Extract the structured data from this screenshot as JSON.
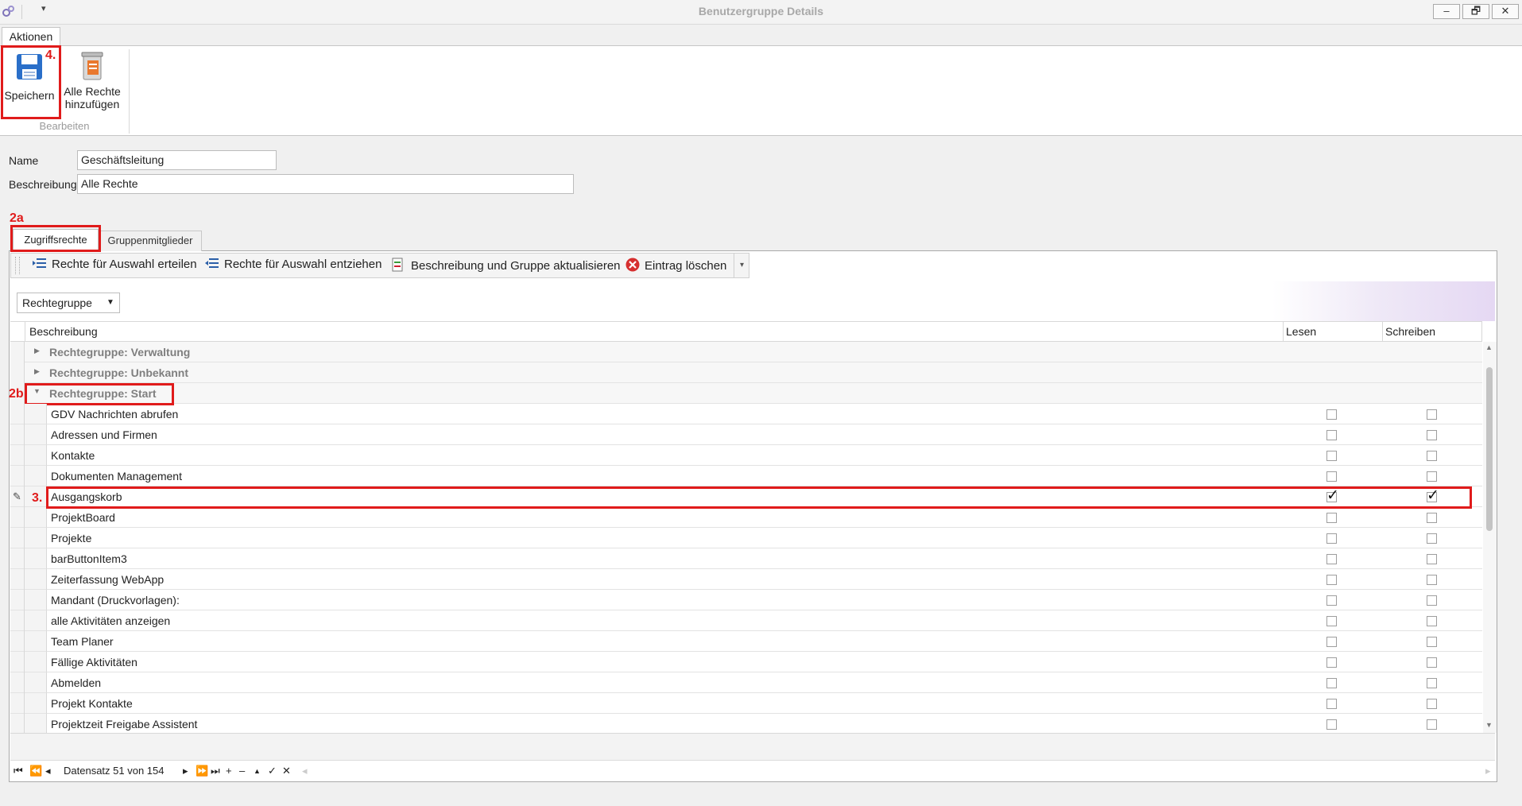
{
  "window": {
    "title": "Benutzergruppe Details",
    "qat_dropdown": "▾",
    "minimize": "–",
    "restore": "🗗",
    "close": "✕"
  },
  "ribbon": {
    "tab_label": "Aktionen",
    "speichern_label": "Speichern",
    "alle_rechte_label_line1": "Alle Rechte",
    "alle_rechte_label_line2": "hinzufügen",
    "group_label": "Bearbeiten"
  },
  "form": {
    "name_label": "Name",
    "name_value": "Geschäftsleitung",
    "beschreibung_label": "Beschreibung",
    "beschreibung_value": "Alle Rechte"
  },
  "annotations": {
    "a4": "4.",
    "a2a": "2a",
    "a2b": "2b",
    "a3": "3."
  },
  "page_tabs": {
    "zugriff": "Zugriffsrechte",
    "gruppen": "Gruppenmitglieder"
  },
  "toolbar": {
    "erteilen": "Rechte für Auswahl erteilen",
    "entziehen": "Rechte für Auswahl entziehen",
    "aktualisieren": "Beschreibung und Gruppe aktualisieren",
    "loeschen": "Eintrag löschen"
  },
  "grid": {
    "group_by_button": "Rechtegruppe",
    "columns": {
      "beschreibung": "Beschreibung",
      "lesen": "Lesen",
      "schreiben": "Schreiben"
    },
    "groups": [
      "Rechtegruppe: Verwaltung",
      "Rechtegruppe: Unbekannt",
      "Rechtegruppe: Start"
    ],
    "rows": [
      {
        "label": "GDV Nachrichten abrufen",
        "lesen": false,
        "schreiben": false
      },
      {
        "label": "Adressen und Firmen",
        "lesen": false,
        "schreiben": false
      },
      {
        "label": "Kontakte",
        "lesen": false,
        "schreiben": false
      },
      {
        "label": "Dokumenten Management",
        "lesen": false,
        "schreiben": false
      },
      {
        "label": "Ausgangskorb",
        "lesen": true,
        "schreiben": true
      },
      {
        "label": "ProjektBoard",
        "lesen": false,
        "schreiben": false
      },
      {
        "label": "Projekte",
        "lesen": false,
        "schreiben": false
      },
      {
        "label": "barButtonItem3",
        "lesen": false,
        "schreiben": false
      },
      {
        "label": "Zeiterfassung WebApp",
        "lesen": false,
        "schreiben": false
      },
      {
        "label": "Mandant (Druckvorlagen):",
        "lesen": false,
        "schreiben": false
      },
      {
        "label": "alle Aktivitäten anzeigen",
        "lesen": false,
        "schreiben": false
      },
      {
        "label": "Team Planer",
        "lesen": false,
        "schreiben": false
      },
      {
        "label": "Fällige Aktivitäten",
        "lesen": false,
        "schreiben": false
      },
      {
        "label": "Abmelden",
        "lesen": false,
        "schreiben": false
      },
      {
        "label": "Projekt Kontakte",
        "lesen": false,
        "schreiben": false
      },
      {
        "label": "Projektzeit Freigabe Assistent",
        "lesen": false,
        "schreiben": false
      }
    ]
  },
  "navigator": {
    "record_text": "Datensatz 51 von 154"
  }
}
